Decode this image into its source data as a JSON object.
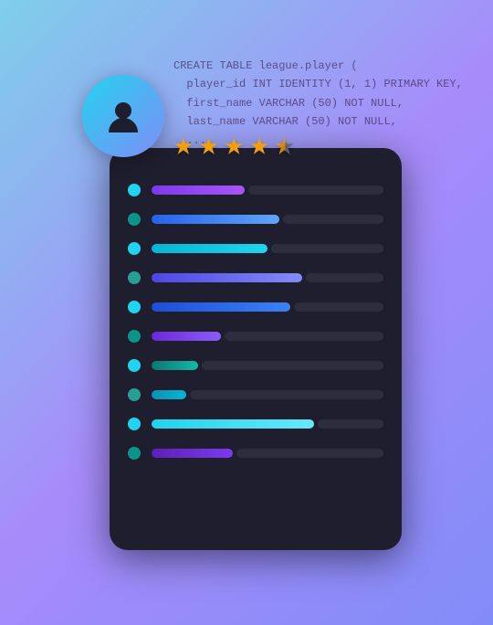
{
  "background": {
    "gradient_start": "#7ecfea",
    "gradient_end": "#818cf8"
  },
  "code_snippet": "CREATE TABLE league.player (\n  player_id INT IDENTITY (1, 1) PRIMARY KEY,\n  first_name VARCHAR (50) NOT NULL,\n  last_name VARCHAR (50) NOT NULL,\n  ...\n  ...re_id)\n  ...CASCADE,\n  ...\n  ...ff_id)\n  ...E NO",
  "stars": {
    "full": 4,
    "half": 1,
    "color": "#f59e0b"
  },
  "rows": [
    {
      "dot": "cyan",
      "bar_class": "bar-purple",
      "bar_width": "w-40",
      "id": 1
    },
    {
      "dot": "teal",
      "bar_class": "bar-blue",
      "bar_width": "w-55",
      "id": 2
    },
    {
      "dot": "cyan",
      "bar_class": "bar-cyan-bright",
      "bar_width": "w-50",
      "id": 3
    },
    {
      "dot": "teal",
      "bar_class": "bar-indigo",
      "bar_width": "w-65",
      "id": 4
    },
    {
      "dot": "cyan",
      "bar_class": "bar-blue2",
      "bar_width": "w-60",
      "id": 5
    },
    {
      "dot": "teal",
      "bar_class": "bar-purple2",
      "bar_width": "w-30",
      "id": 6
    },
    {
      "dot": "cyan",
      "bar_class": "bar-teal",
      "bar_width": "w-20",
      "id": 7
    },
    {
      "dot": "teal",
      "bar_class": "bar-cyan2",
      "bar_width": "w-15",
      "id": 8
    },
    {
      "dot": "cyan",
      "bar_class": "bar-cyan3",
      "bar_width": "w-70",
      "id": 9
    },
    {
      "dot": "teal",
      "bar_class": "bar-purple3",
      "bar_width": "w-35",
      "id": 10
    }
  ]
}
